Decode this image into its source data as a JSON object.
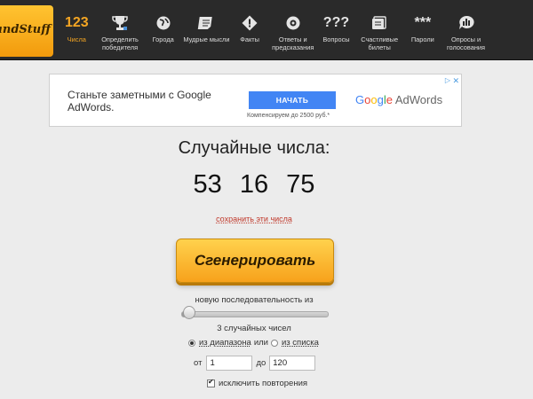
{
  "logo": {
    "text": "andStuff"
  },
  "nav": {
    "items": [
      {
        "icon": "123",
        "label": "Числа",
        "active": true,
        "name": "numbers"
      },
      {
        "icon": "trophy-icon",
        "label": "Определить победителя",
        "name": "winner"
      },
      {
        "icon": "globe-icon",
        "label": "Города",
        "name": "cities"
      },
      {
        "icon": "scroll-icon",
        "label": "Мудрые мысли",
        "name": "wisdom"
      },
      {
        "icon": "exclamation-icon",
        "label": "Факты",
        "name": "facts"
      },
      {
        "icon": "answer-ball-icon",
        "label": "Ответы и предсказания",
        "name": "answers"
      },
      {
        "icon": "???",
        "label": "Вопросы",
        "name": "questions"
      },
      {
        "icon": "ticket-icon",
        "label": "Счастливые билеты",
        "name": "tickets"
      },
      {
        "icon": "***",
        "label": "Пароли",
        "name": "passwords"
      },
      {
        "icon": "poll-icon",
        "label": "Опросы и голосования",
        "name": "polls"
      }
    ],
    "active_color": "#f5a623"
  },
  "ad": {
    "text": "Станьте заметными с Google AdWords.",
    "button": "НАЧАТЬ",
    "sub": "Компенсируем до 2500 руб.*",
    "brand_google": [
      "G",
      "o",
      "o",
      "g",
      "l",
      "e"
    ],
    "brand_adwords": " AdWords"
  },
  "main": {
    "heading": "Случайные числа:",
    "numbers": "53 16 75",
    "save_link": "сохранить эти числа",
    "generate_button": "Сгенерировать",
    "sequence_label": "новую последовательность из",
    "slider_value": 3,
    "slider_min": 1,
    "slider_max": 100,
    "count_label": "3 случайных чисел",
    "range_option": "из диапазона",
    "or_word": "или",
    "list_option": "из списка",
    "from_label": "от",
    "from_value": "1",
    "to_label": "до",
    "to_value": "120",
    "exclude_label": "исключить повторения"
  }
}
